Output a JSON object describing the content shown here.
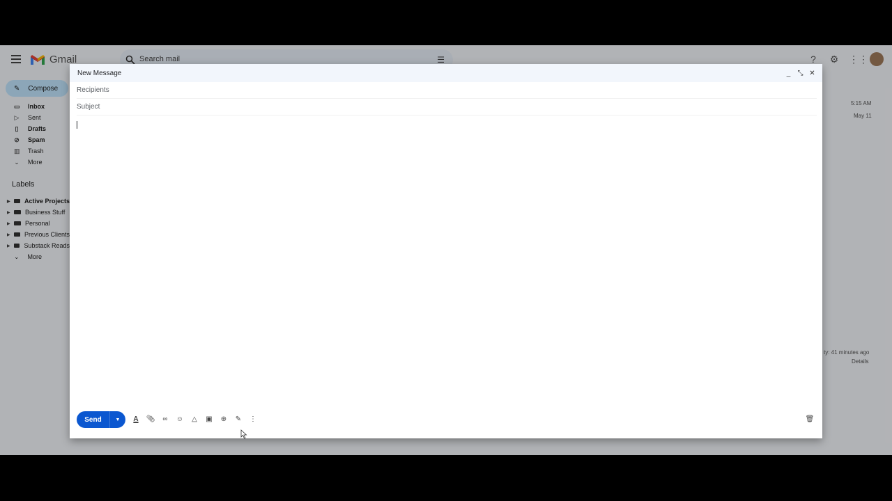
{
  "app": {
    "name": "Gmail"
  },
  "search": {
    "placeholder": "Search mail"
  },
  "sidebar": {
    "compose_label": "Compose",
    "items": [
      {
        "label": "Inbox",
        "icon": "inbox-icon",
        "bold": true
      },
      {
        "label": "Sent",
        "icon": "send-icon",
        "bold": false
      },
      {
        "label": "Drafts",
        "icon": "draft-icon",
        "bold": true
      },
      {
        "label": "Spam",
        "icon": "spam-icon",
        "bold": true
      },
      {
        "label": "Trash",
        "icon": "trash-icon",
        "bold": false
      },
      {
        "label": "More",
        "icon": "chevron-down-icon",
        "bold": false
      }
    ],
    "labels_title": "Labels",
    "labels": [
      {
        "label": "Active Projects",
        "bold": true
      },
      {
        "label": "Business Stuff",
        "bold": false
      },
      {
        "label": "Personal",
        "bold": false
      },
      {
        "label": "Previous Clients",
        "bold": false
      },
      {
        "label": "Substack Reads",
        "bold": false
      }
    ],
    "labels_more": "More"
  },
  "mail_list": {
    "times": [
      "5:15 AM",
      "May 11"
    ],
    "activity": "ty: 41 minutes ago",
    "details": "Details"
  },
  "compose": {
    "title": "New Message",
    "recipients_placeholder": "Recipients",
    "subject_placeholder": "Subject",
    "send_label": "Send",
    "tools": [
      "formatting-options-icon",
      "attach-file-icon",
      "insert-link-icon",
      "insert-emoji-icon",
      "google-drive-icon",
      "insert-photo-icon",
      "confidential-mode-icon",
      "insert-signature-icon",
      "more-options-icon"
    ]
  },
  "colors": {
    "send_button": "#0b57d0",
    "compose_header": "#f2f6fc",
    "compose_pill": "#c2e7ff"
  }
}
